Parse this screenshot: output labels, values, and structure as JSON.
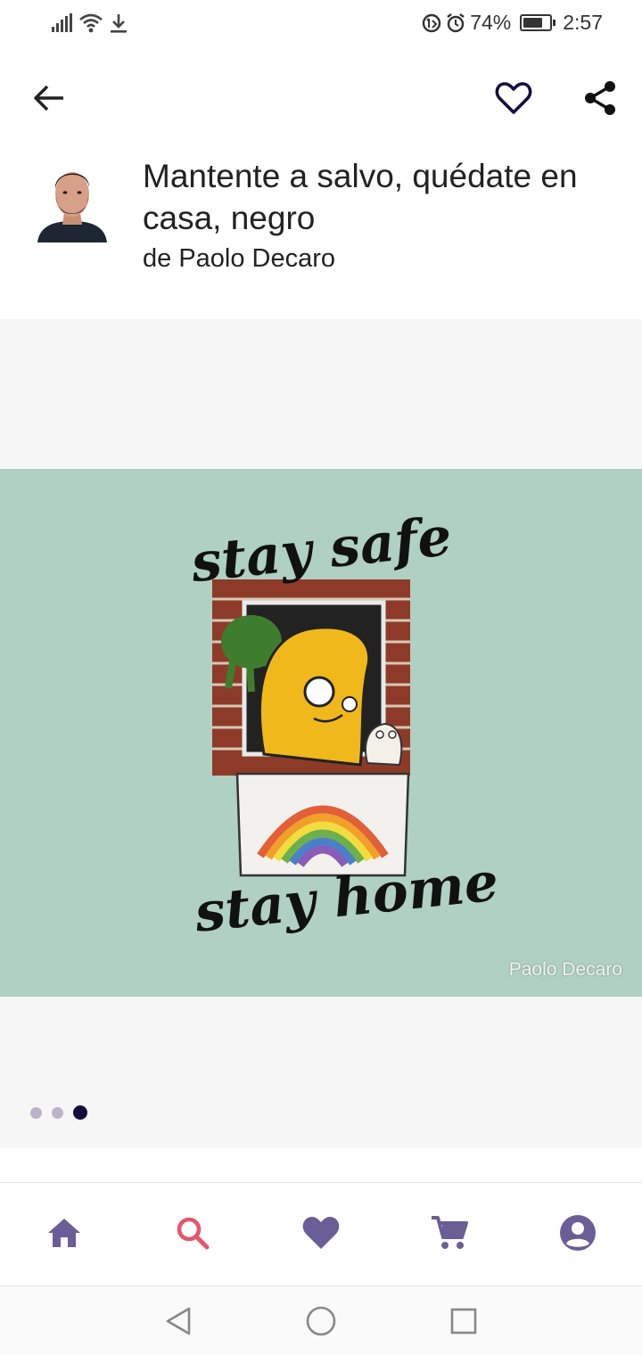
{
  "status_bar": {
    "battery_percent": "74%",
    "battery_level": 0.74,
    "time": "2:57",
    "icons": [
      "signal-icon",
      "wifi-icon",
      "download-icon",
      "data-saver-icon",
      "alarm-icon",
      "battery-icon"
    ]
  },
  "app_bar": {
    "icons": [
      "back-arrow-icon",
      "heart-outline-icon",
      "share-icon"
    ]
  },
  "product": {
    "title": "Mantente a salvo, quédate en casa, negro",
    "author": "de Paolo Decaro"
  },
  "artwork": {
    "text_top": "stay safe",
    "text_bottom": "stay home",
    "watermark": "Paolo Decaro",
    "background_color": "#afd0c3"
  },
  "carousel": {
    "page_count": 3,
    "active_index": 2
  },
  "bottom_nav": {
    "items": [
      "home-icon",
      "search-icon",
      "favorites-icon",
      "cart-icon",
      "account-icon"
    ],
    "active": "search-icon",
    "colors": {
      "default": "#6a5e96",
      "active": "#e5566a"
    }
  },
  "system_nav": {
    "items": [
      "back-triangle-icon",
      "home-circle-icon",
      "recents-square-icon"
    ]
  }
}
